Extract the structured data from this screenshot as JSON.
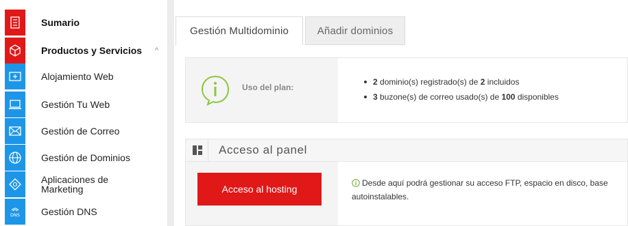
{
  "sidebar": {
    "items": [
      {
        "label": "Sumario",
        "icon": "list-icon",
        "icon_bg": "#e01818",
        "bold": true
      },
      {
        "label": "Productos y Servicios",
        "icon": "cube-icon",
        "icon_bg": "#e01818",
        "bold": true,
        "chevron": "^"
      },
      {
        "label": "Alojamiento Web",
        "icon": "hosting-icon",
        "icon_bg": "#1e96e8"
      },
      {
        "label": "Gestión Tu Web",
        "icon": "laptop-icon",
        "icon_bg": "#1e96e8"
      },
      {
        "label": "Gestión de Correo",
        "icon": "mail-icon",
        "icon_bg": "#1e96e8"
      },
      {
        "label": "Gestión de Dominios",
        "icon": "globe-icon",
        "icon_bg": "#1e96e8"
      },
      {
        "label": "Aplicaciones de Marketing",
        "label_line1": "Aplicaciones de",
        "label_line2": "Marketing",
        "icon": "marketing-icon",
        "icon_bg": "#1e96e8"
      },
      {
        "label": "Gestión DNS",
        "icon": "dns-icon",
        "icon_bg": "#1e96e8",
        "icon_text": "DNS"
      }
    ]
  },
  "tabs": [
    {
      "label": "Gestión Multidominio",
      "active": true
    },
    {
      "label": "Añadir dominios",
      "active": false
    }
  ],
  "plan": {
    "label": "Uso del plan:",
    "domains_used": "2",
    "domains_text": " dominio(s) registrado(s) de ",
    "domains_total": "2",
    "domains_suffix": " incluidos",
    "mail_used": "3",
    "mail_text": " buzone(s) de correo usado(s) de ",
    "mail_total": "100",
    "mail_suffix": " disponibles"
  },
  "panel_access": {
    "title": "Acceso al panel",
    "button_label": "Acceso al hosting",
    "description": "Desde aquí podrá gestionar su acceso FTP, espacio en disco, base",
    "description_line2": "autoinstalables."
  },
  "colors": {
    "red": "#e01818",
    "blue": "#1e96e8",
    "green": "#8cc63f"
  }
}
